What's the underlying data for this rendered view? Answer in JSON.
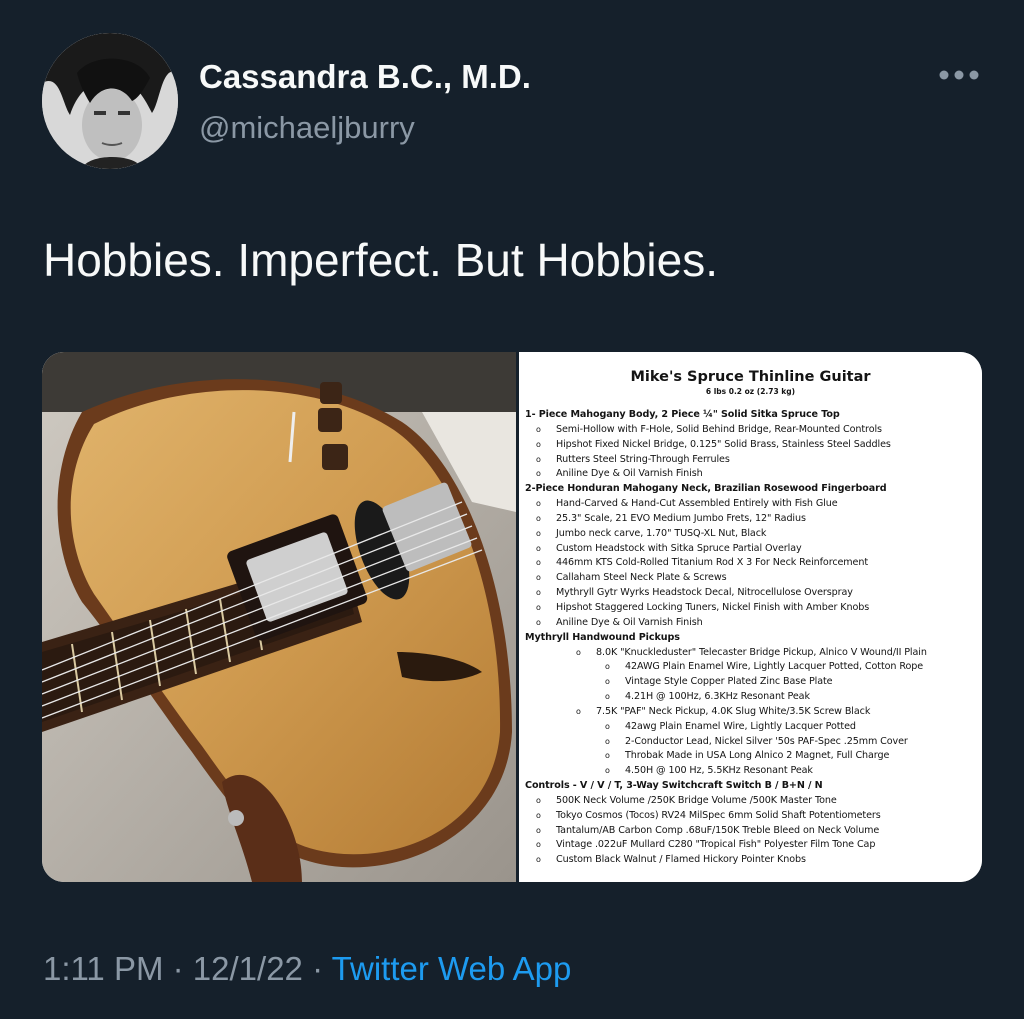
{
  "author": {
    "display_name": "Cassandra B.C., M.D.",
    "handle": "@michaeljburry"
  },
  "tweet": {
    "text": "Hobbies. Imperfect. But Hobbies."
  },
  "menu": {
    "icon": "more-horizontal-icon"
  },
  "spec_sheet": {
    "title": "Mike's Spruce Thinline Guitar",
    "weight": "6 lbs 0.2 oz (2.73 kg)",
    "lines": [
      {
        "level": 0,
        "text": "1- Piece Mahogany Body, 2 Piece ¼\" Solid Sitka Spruce Top"
      },
      {
        "level": 1,
        "text": "Semi-Hollow with F-Hole, Solid Behind Bridge, Rear-Mounted Controls"
      },
      {
        "level": 1,
        "text": "Hipshot Fixed Nickel Bridge, 0.125\" Solid Brass, Stainless Steel Saddles"
      },
      {
        "level": 1,
        "text": "Rutters Steel String-Through Ferrules"
      },
      {
        "level": 1,
        "text": "Aniline Dye & Oil Varnish Finish"
      },
      {
        "level": 0,
        "text": "2-Piece Honduran Mahogany Neck, Brazilian Rosewood Fingerboard"
      },
      {
        "level": 1,
        "text": "Hand-Carved & Hand-Cut Assembled Entirely with Fish Glue"
      },
      {
        "level": 1,
        "text": "25.3\" Scale, 21 EVO Medium Jumbo Frets, 12\" Radius"
      },
      {
        "level": 1,
        "text": "Jumbo neck carve, 1.70\" TUSQ-XL Nut, Black"
      },
      {
        "level": 1,
        "text": "Custom Headstock with Sitka Spruce Partial Overlay"
      },
      {
        "level": 1,
        "text": "446mm KTS Cold-Rolled Titanium Rod X 3 For Neck Reinforcement"
      },
      {
        "level": 1,
        "text": "Callaham Steel Neck Plate & Screws"
      },
      {
        "level": 1,
        "text": "Mythryll Gytr Wyrks Headstock Decal, Nitrocellulose Overspray"
      },
      {
        "level": 1,
        "text": "Hipshot Staggered Locking Tuners, Nickel Finish with Amber Knobs"
      },
      {
        "level": 1,
        "text": "Aniline Dye & Oil Varnish Finish"
      },
      {
        "level": 0,
        "text": "Mythryll Handwound Pickups"
      },
      {
        "level": 2,
        "text": "8.0K \"Knuckleduster\" Telecaster Bridge Pickup, Alnico V Wound/II Plain"
      },
      {
        "level": 3,
        "text": "42AWG Plain Enamel Wire, Lightly Lacquer Potted, Cotton Rope"
      },
      {
        "level": 3,
        "text": "Vintage Style Copper Plated Zinc Base Plate"
      },
      {
        "level": 3,
        "text": "4.21H @ 100Hz, 6.3KHz Resonant Peak"
      },
      {
        "level": 2,
        "text": "7.5K \"PAF\" Neck Pickup, 4.0K Slug White/3.5K Screw Black"
      },
      {
        "level": 3,
        "text": "42awg Plain Enamel Wire, Lightly Lacquer Potted"
      },
      {
        "level": 3,
        "text": "2-Conductor Lead, Nickel Silver '50s PAF-Spec .25mm Cover"
      },
      {
        "level": 3,
        "text": "Throbak Made in USA Long Alnico 2 Magnet, Full Charge"
      },
      {
        "level": 3,
        "text": "4.50H @ 100 Hz, 5.5KHz Resonant Peak"
      },
      {
        "level": 0,
        "text": "Controls - V / V / T, 3-Way Switchcraft Switch B / B+N / N"
      },
      {
        "level": 1,
        "text": "500K Neck Volume /250K Bridge Volume /500K Master Tone"
      },
      {
        "level": 1,
        "text": "Tokyo Cosmos (Tocos) RV24 MilSpec 6mm Solid Shaft Potentiometers"
      },
      {
        "level": 1,
        "text": "Tantalum/AB Carbon Comp .68uF/150K Treble Bleed on Neck Volume"
      },
      {
        "level": 1,
        "text": "Vintage .022uF Mullard C280 \"Tropical Fish\" Polyester Film Tone Cap"
      },
      {
        "level": 1,
        "text": "Custom Black Walnut / Flamed Hickory Pointer Knobs"
      }
    ]
  },
  "footer": {
    "time": "1:11 PM",
    "sep": "·",
    "date": "12/1/22",
    "source": "Twitter Web App"
  },
  "colors": {
    "background": "#15202b",
    "primary_text": "#f7f9f9",
    "secondary_text": "#8b98a5",
    "link": "#1d9bf0"
  }
}
